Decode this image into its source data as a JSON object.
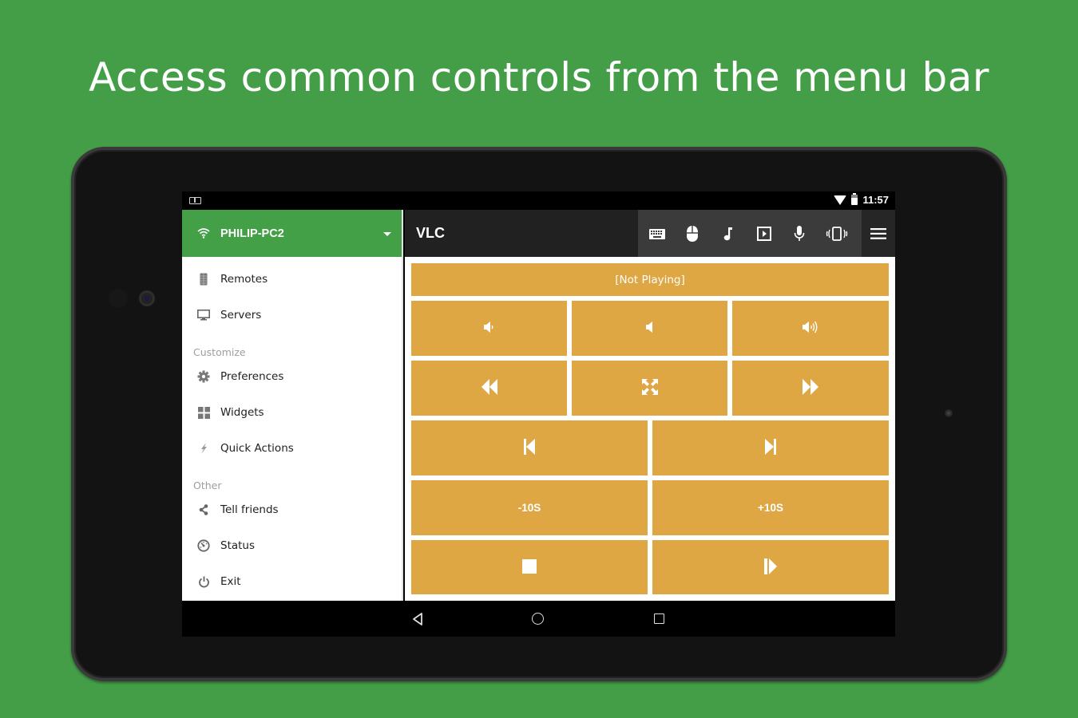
{
  "headline": "Access common controls from the menu bar",
  "status_bar": {
    "time": "11:57",
    "icons": [
      "notification-icon",
      "wifi-icon",
      "battery-icon"
    ]
  },
  "drawer": {
    "server_name": "PHILIP-PC2",
    "server_icon": "wifi-icon",
    "items": [
      {
        "label": "Remotes",
        "icon": "remote-icon"
      },
      {
        "label": "Servers",
        "icon": "monitor-icon"
      }
    ],
    "sections": [
      {
        "title": "Customize",
        "items": [
          {
            "label": "Preferences",
            "icon": "gear-icon"
          },
          {
            "label": "Widgets",
            "icon": "grid-icon"
          },
          {
            "label": "Quick Actions",
            "icon": "lightning-icon"
          }
        ]
      },
      {
        "title": "Other",
        "items": [
          {
            "label": "Tell friends",
            "icon": "share-icon"
          },
          {
            "label": "Status",
            "icon": "gauge-icon"
          },
          {
            "label": "Exit",
            "icon": "power-icon"
          }
        ]
      }
    ]
  },
  "appbar": {
    "title": "VLC",
    "actions": [
      "keyboard-icon",
      "mouse-icon",
      "music-note-icon",
      "media-play-icon",
      "microphone-icon",
      "vibrate-phone-icon"
    ],
    "menu_icon": "hamburger-menu-icon"
  },
  "remote": {
    "now_playing": "[Not Playing]",
    "buttons": {
      "volume_down": "volume-down-icon",
      "mute": "volume-mute-icon",
      "volume_up": "volume-up-icon",
      "rewind": "rewind-icon",
      "fullscreen": "fullscreen-icon",
      "fast_forward": "fast-forward-icon",
      "previous": "skip-previous-icon",
      "next": "skip-next-icon",
      "back_10": "-10S",
      "forward_10": "+10S",
      "stop": "stop-icon",
      "play_pause": "play-pause-icon"
    },
    "accent_color": "#dfa644"
  },
  "colors": {
    "background": "#449e48",
    "drawer_header": "#44a046",
    "appbar": "#212121"
  },
  "navbar": {
    "buttons": [
      "back-icon",
      "home-icon",
      "recents-icon"
    ]
  }
}
